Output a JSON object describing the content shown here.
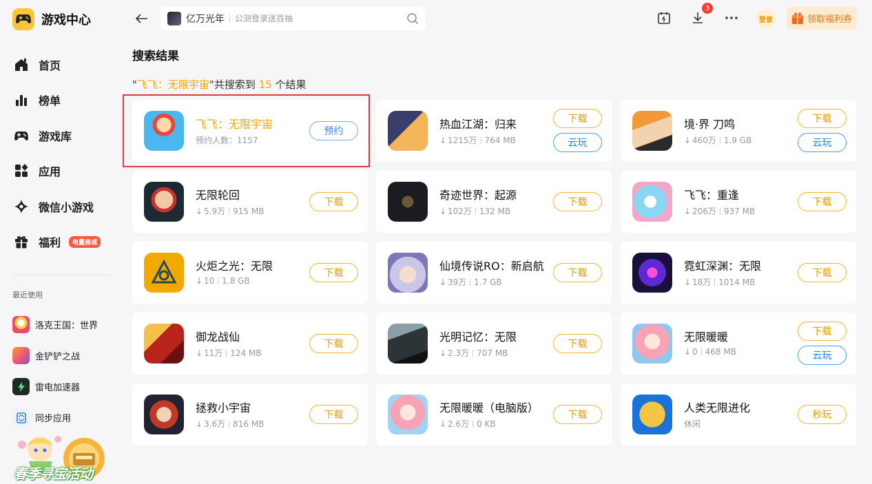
{
  "app": {
    "title": "游戏中心"
  },
  "nav": [
    {
      "label": "首页",
      "icon": "home-icon"
    },
    {
      "label": "榜单",
      "icon": "ranking-icon"
    },
    {
      "label": "游戏库",
      "icon": "gamepad-icon"
    },
    {
      "label": "应用",
      "icon": "apps-icon"
    },
    {
      "label": "微信小游戏",
      "icon": "mini-game-icon"
    },
    {
      "label": "福利",
      "icon": "gift-icon",
      "badge": "电量商城"
    }
  ],
  "recent": {
    "title": "最近使用",
    "items": [
      {
        "label": "洛克王国：世界"
      },
      {
        "label": "金铲铲之战"
      },
      {
        "label": "雷电加速器"
      },
      {
        "label": "同步应用"
      }
    ]
  },
  "promo": {
    "text": "春季寻宝活动"
  },
  "search": {
    "keyword": "亿万光年",
    "placeholder": "公测登录送百抽"
  },
  "topbar": {
    "download_badge": "3",
    "login_label": "登录",
    "coupon_label": "领取福利券"
  },
  "main": {
    "title": "搜索结果",
    "summary": {
      "prefix": "\"",
      "query": "飞飞：无限宇宙",
      "middle": "\"共搜索到 ",
      "count": "15",
      "suffix": " 个结果"
    }
  },
  "colors": {
    "accent": "#f5a400",
    "cloud": "#1e88f0",
    "highlight": "#e03a3a",
    "background": "#f6f6f8"
  },
  "results": [
    {
      "name": "飞飞：无限宇宙",
      "meta_text": "预约人数：1157",
      "buttons": [
        "预约"
      ]
    },
    {
      "name": "热血江湖：归来",
      "downloads": "1215万",
      "size": "764 MB",
      "buttons": [
        "下载",
        "云玩"
      ]
    },
    {
      "name": "境·界 刀鸣",
      "downloads": "460万",
      "size": "1.9 GB",
      "buttons": [
        "下载",
        "云玩"
      ]
    },
    {
      "name": "无限轮回",
      "downloads": "5.9万",
      "size": "915 MB",
      "buttons": [
        "下载"
      ]
    },
    {
      "name": "奇迹世界：起源",
      "downloads": "102万",
      "size": "132 MB",
      "buttons": [
        "下载"
      ]
    },
    {
      "name": "飞飞：重逢",
      "downloads": "206万",
      "size": "937 MB",
      "buttons": [
        "下载"
      ]
    },
    {
      "name": "火炬之光：无限",
      "downloads": "10",
      "size": "1.8 GB",
      "buttons": [
        "下载"
      ]
    },
    {
      "name": "仙境传说RO：新启航",
      "downloads": "39万",
      "size": "1.7 GB",
      "buttons": [
        "下载"
      ]
    },
    {
      "name": "霓虹深渊：无限",
      "downloads": "18万",
      "size": "1014 MB",
      "buttons": [
        "下载"
      ]
    },
    {
      "name": "御龙战仙",
      "downloads": "11万",
      "size": "124 MB",
      "buttons": [
        "下载"
      ]
    },
    {
      "name": "光明记忆：无限",
      "downloads": "2.3万",
      "size": "707 MB",
      "buttons": [
        "下载"
      ]
    },
    {
      "name": "无限暖暖",
      "downloads": "0",
      "size": "468 MB",
      "buttons": [
        "下载",
        "云玩"
      ]
    },
    {
      "name": "拯救小宇宙",
      "downloads": "3.6万",
      "size": "816 MB",
      "buttons": [
        "下载"
      ]
    },
    {
      "name": "无限暖暖（电脑版）",
      "downloads": "2.6万",
      "size": "0 KB",
      "buttons": [
        "下载"
      ]
    },
    {
      "name": "人类无限进化",
      "meta_text": "休闲",
      "buttons": [
        "秒玩"
      ]
    }
  ]
}
